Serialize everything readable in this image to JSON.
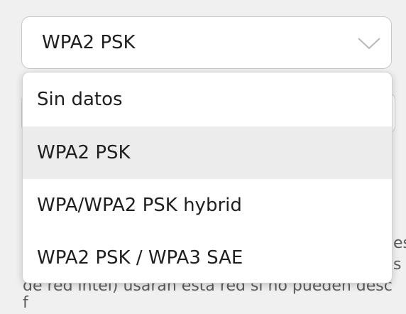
{
  "select": {
    "value": "WPA2 PSK",
    "icon": "chevron-down-icon"
  },
  "dropdown": {
    "options": [
      "Sin datos",
      "WPA2 PSK",
      "WPA/WPA2 PSK hybrid",
      "WPA2 PSK / WPA3 SAE"
    ],
    "selected_index": 1
  },
  "background": {
    "fragment_1": "es",
    "fragment_2": "s c",
    "fragment_3": "de red intel) usarán esta red si no pueden desc",
    "fragment_4": "f"
  },
  "colors": {
    "page_bg": "#f0f0f0",
    "selected_option_bg": "#ececec",
    "border": "#c8c8c8",
    "text": "#1f1f1f"
  }
}
